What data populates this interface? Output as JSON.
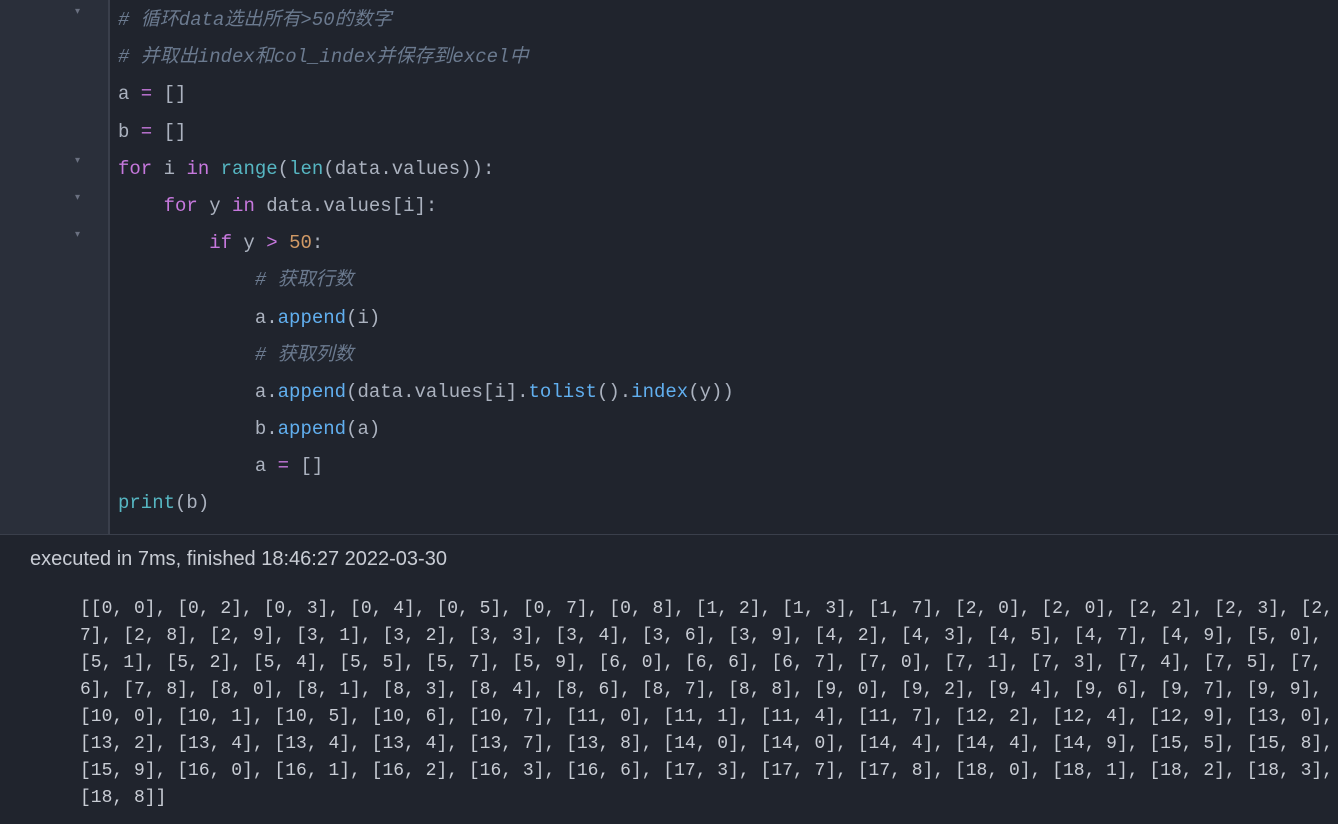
{
  "gutter": {
    "markers": [
      "▾",
      "",
      "",
      "",
      "▾",
      "▾",
      "▾",
      "",
      "",
      "",
      "",
      "",
      "",
      ""
    ]
  },
  "code": {
    "l1_comment": "# 循环data选出所有>50的数字",
    "l2_comment": "# 并取出index和col_index并保存到excel中",
    "l3_a": "a",
    "l3_eq": " = ",
    "l3_br": "[]",
    "l4_b": "b",
    "l4_eq": " = ",
    "l4_br": "[]",
    "l5_for": "for",
    "l5_i": " i ",
    "l5_in": "in",
    "l5_sp": " ",
    "l5_range": "range",
    "l5_p1": "(",
    "l5_len": "len",
    "l5_p2": "(",
    "l5_data": "data",
    "l5_dot": ".",
    "l5_values": "values",
    "l5_p3": "))",
    "l5_colon": ":",
    "l6_for": "for",
    "l6_y": " y ",
    "l6_in": "in",
    "l6_sp": " ",
    "l6_data": "data",
    "l6_dot": ".",
    "l6_values": "values",
    "l6_br1": "[",
    "l6_i": "i",
    "l6_br2": "]",
    "l6_colon": ":",
    "l7_if": "if",
    "l7_y": " y ",
    "l7_gt": ">",
    "l7_sp": " ",
    "l7_50": "50",
    "l7_colon": ":",
    "l8_comment": "# 获取行数",
    "l9_a": "a",
    "l9_dot": ".",
    "l9_append": "append",
    "l9_p1": "(",
    "l9_i": "i",
    "l9_p2": ")",
    "l10_comment": "# 获取列数",
    "l11_a": "a",
    "l11_dot": ".",
    "l11_append": "append",
    "l11_p1": "(",
    "l11_data": "data",
    "l11_dot2": ".",
    "l11_values": "values",
    "l11_br1": "[",
    "l11_i": "i",
    "l11_br2": "]",
    "l11_dot3": ".",
    "l11_tolist": "tolist",
    "l11_p2": "()",
    "l11_dot4": ".",
    "l11_index": "index",
    "l11_p3": "(",
    "l11_y": "y",
    "l11_p4": "))",
    "l12_b": "b",
    "l12_dot": ".",
    "l12_append": "append",
    "l12_p1": "(",
    "l12_a": "a",
    "l12_p2": ")",
    "l13_a": "a",
    "l13_eq": " = ",
    "l13_br": "[]",
    "l14_print": "print",
    "l14_p1": "(",
    "l14_b": "b",
    "l14_p2": ")"
  },
  "execution": {
    "text": "executed in 7ms, finished 18:46:27 2022-03-30"
  },
  "output": {
    "text": "[[0, 0], [0, 2], [0, 3], [0, 4], [0, 5], [0, 7], [0, 8], [1, 2], [1, 3], [1, 7], [2, 0], [2, 0], [2, 2], [2, 3], [2, 7], [2, 8], [2, 9], [3, 1], [3, 2], [3, 3], [3, 4], [3, 6], [3, 9], [4, 2], [4, 3], [4, 5], [4, 7], [4, 9], [5, 0], [5, 1], [5, 2], [5, 4], [5, 5], [5, 7], [5, 9], [6, 0], [6, 6], [6, 7], [7, 0], [7, 1], [7, 3], [7, 4], [7, 5], [7, 6], [7, 8], [8, 0], [8, 1], [8, 3], [8, 4], [8, 6], [8, 7], [8, 8], [9, 0], [9, 2], [9, 4], [9, 6], [9, 7], [9, 9], [10, 0], [10, 1], [10, 5], [10, 6], [10, 7], [11, 0], [11, 1], [11, 4], [11, 7], [12, 2], [12, 4], [12, 9], [13, 0], [13, 2], [13, 4], [13, 4], [13, 4], [13, 7], [13, 8], [14, 0], [14, 0], [14, 4], [14, 4], [14, 9], [15, 5], [15, 8], [15, 9], [16, 0], [16, 1], [16, 2], [16, 3], [16, 6], [17, 3], [17, 7], [17, 8], [18, 0], [18, 1], [18, 2], [18, 3], [18, 8]]"
  }
}
